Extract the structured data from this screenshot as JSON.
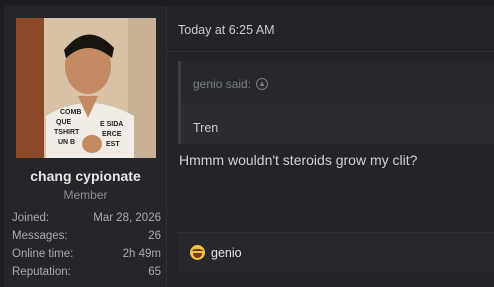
{
  "user": {
    "name": "chang cypionate",
    "role": "Member",
    "avatar_icon": "user-avatar-photo",
    "stats": [
      {
        "label": "Joined:",
        "value": "Mar 28, 2026"
      },
      {
        "label": "Messages:",
        "value": "26"
      },
      {
        "label": "Online time:",
        "value": "2h 49m"
      },
      {
        "label": "Reputation:",
        "value": "65"
      }
    ]
  },
  "post": {
    "timestamp": "Today at 6:25 AM",
    "quote": {
      "author": "genio said:",
      "icon": "arrow-up-circle-icon",
      "text": "Tren"
    },
    "body": "Hmmm wouldn't steroids grow my clit?",
    "reaction": {
      "icon": "laughing-emoji-icon",
      "user": "genio"
    }
  },
  "colors": {
    "background": "#1d1e20",
    "panel": "#252629",
    "text": "#cfd1d4",
    "muted": "#8b8d90"
  }
}
